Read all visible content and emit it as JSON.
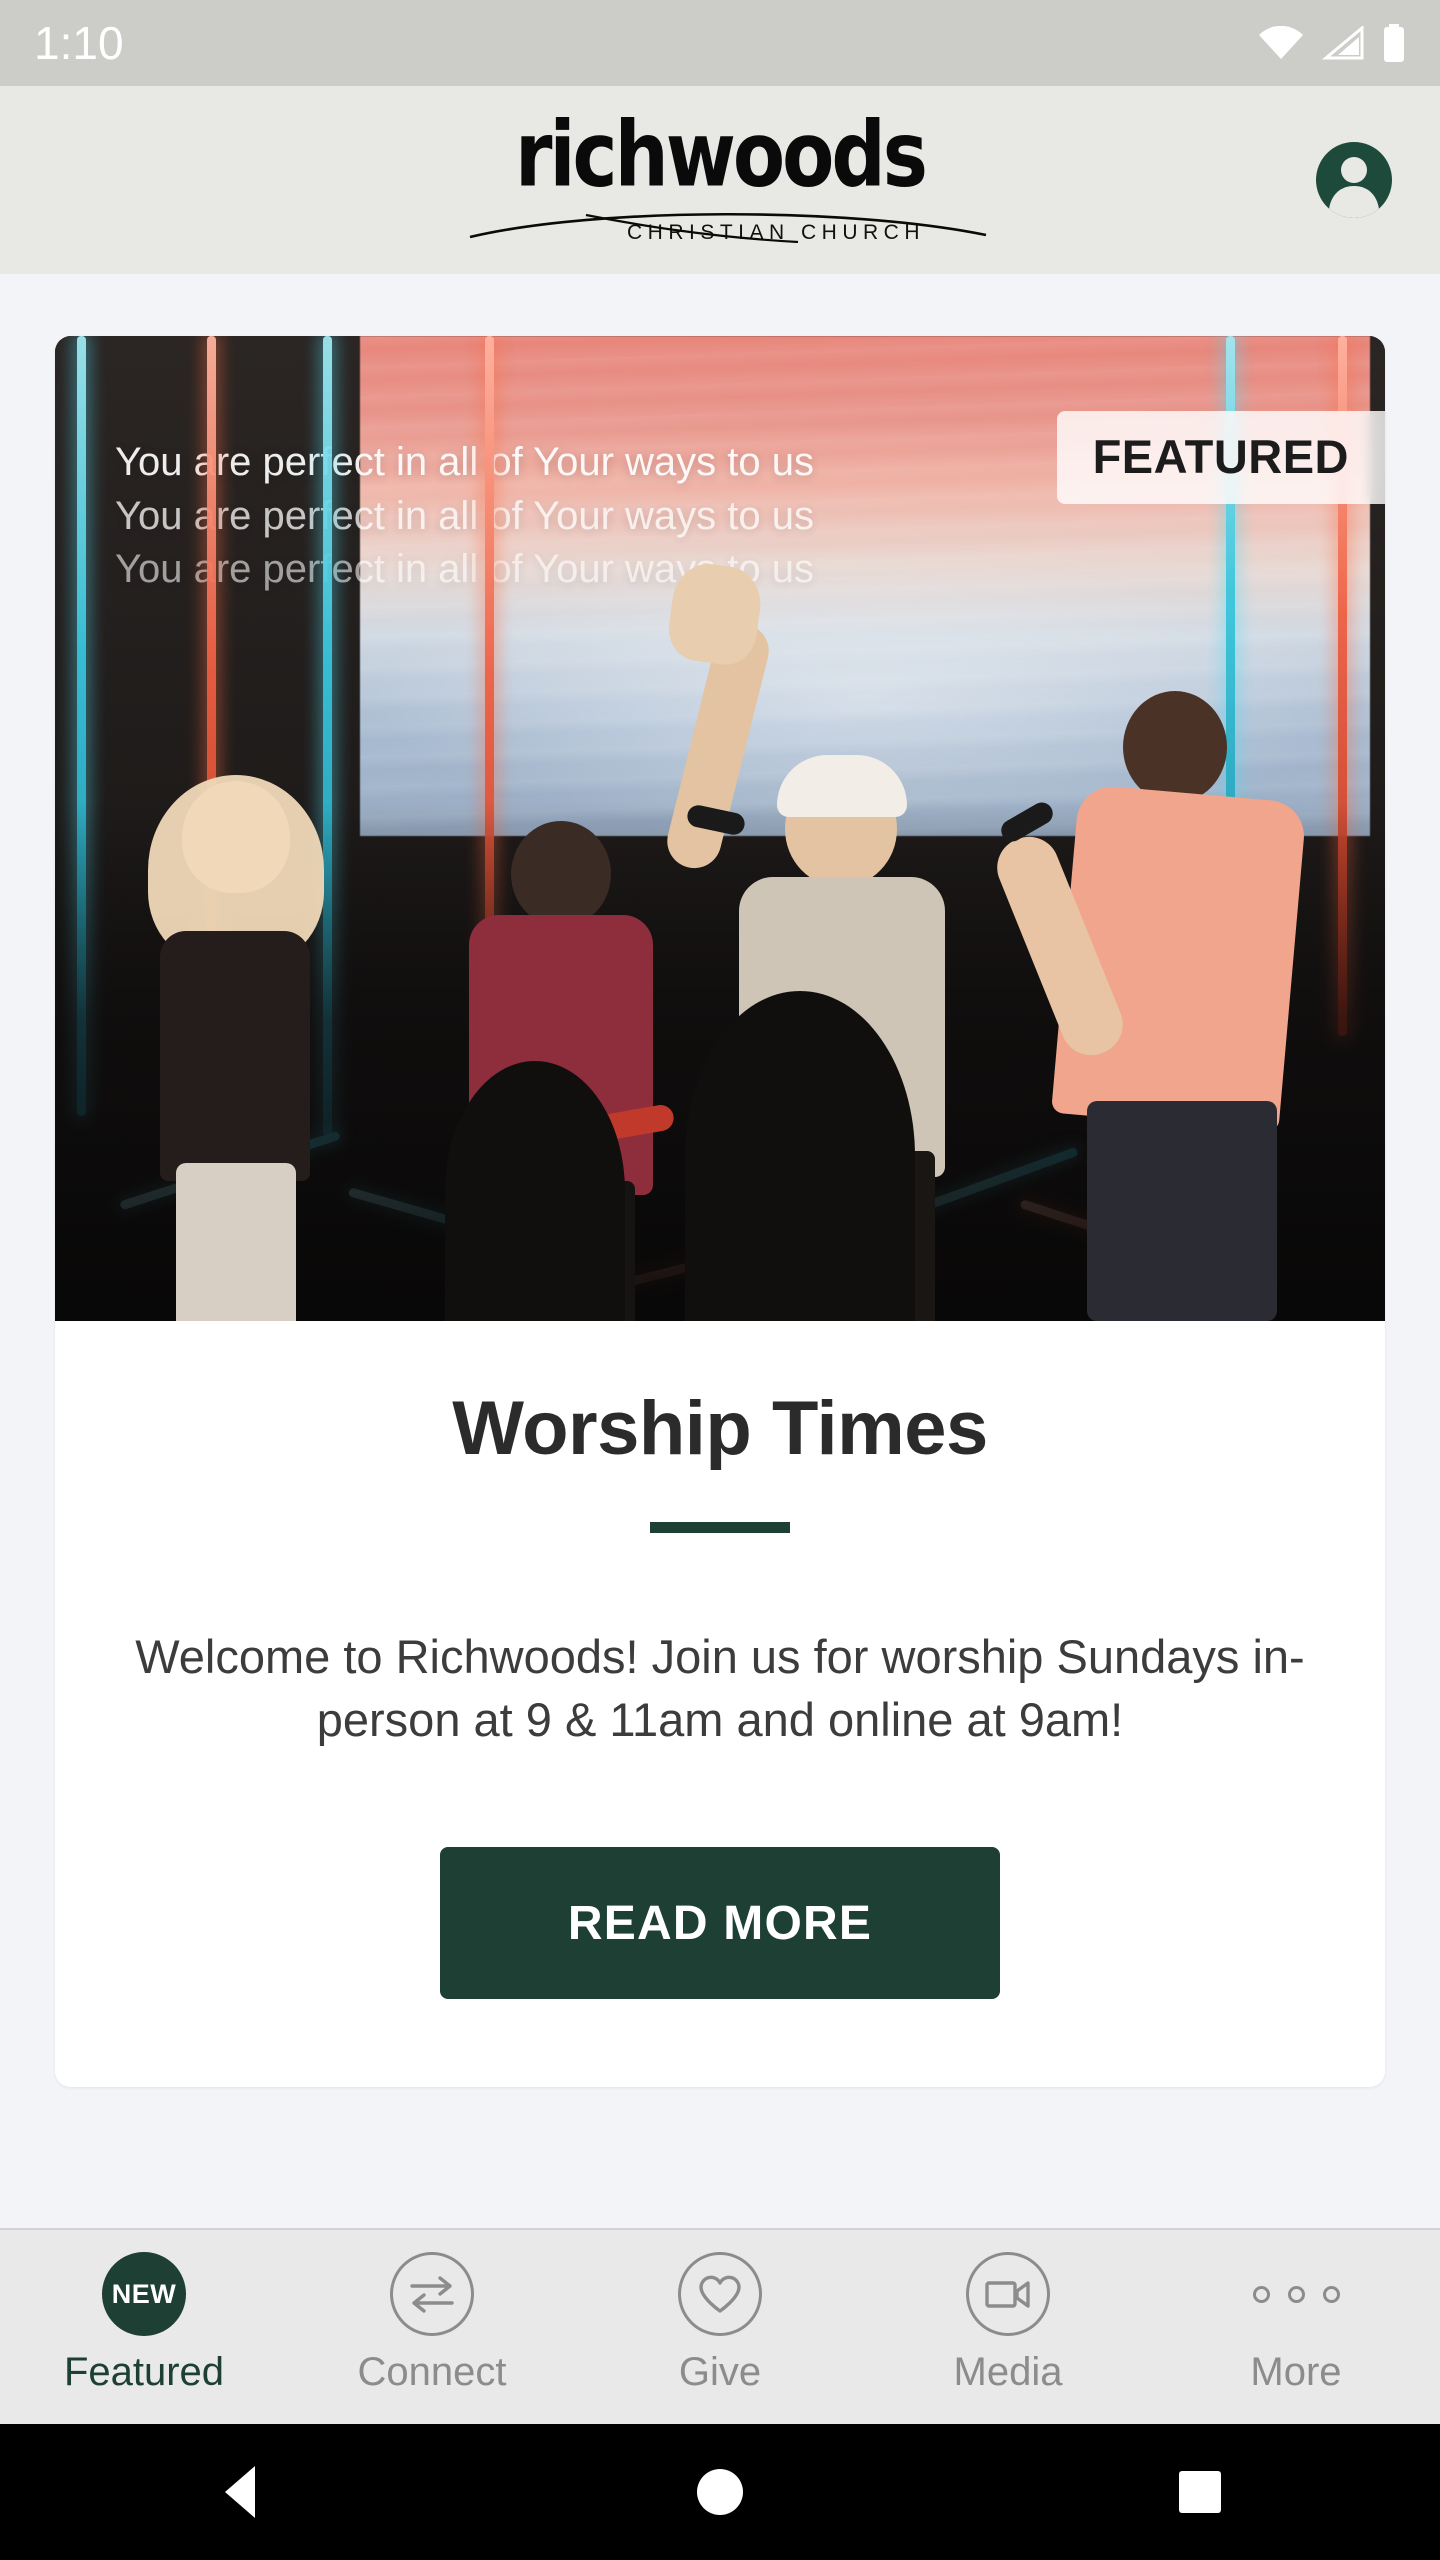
{
  "status_bar": {
    "time": "1:10",
    "icons": [
      "wifi-icon",
      "cellular-signal-icon",
      "battery-icon"
    ]
  },
  "header": {
    "logo_word": "richwoods",
    "logo_subtitle": "CHRISTIAN CHURCH",
    "avatar_label": "account-avatar"
  },
  "featured_card": {
    "badge": "FEATURED",
    "hero_lyrics": [
      "You are perfect in all of Your ways to us",
      "You are perfect in all of Your ways to us",
      "You are perfect in all of Your ways to us"
    ],
    "title": "Worship Times",
    "description": "Welcome to Richwoods! Join us for worship Sundays in-person at 9 & 11am and online at 9am!",
    "button_label": "READ MORE"
  },
  "tabbar": {
    "tabs": [
      {
        "label": "Featured",
        "icon": "new-badge-icon",
        "badge_text": "NEW",
        "active": true
      },
      {
        "label": "Connect",
        "icon": "exchange-arrows-icon",
        "active": false
      },
      {
        "label": "Give",
        "icon": "heart-icon",
        "active": false
      },
      {
        "label": "Media",
        "icon": "video-camera-icon",
        "active": false
      },
      {
        "label": "More",
        "icon": "three-dots-icon",
        "active": false
      }
    ]
  },
  "android_nav": {
    "back": "back-button",
    "home": "home-button",
    "recents": "recents-button"
  },
  "colors": {
    "brand_green": "#1E4034",
    "header_bg": "#E8E8E4",
    "page_bg": "#F2F4F8",
    "status_bg": "#CCCCC9",
    "tabbar_bg": "#E9E9E9",
    "inactive_grey": "#8C8C8C"
  }
}
